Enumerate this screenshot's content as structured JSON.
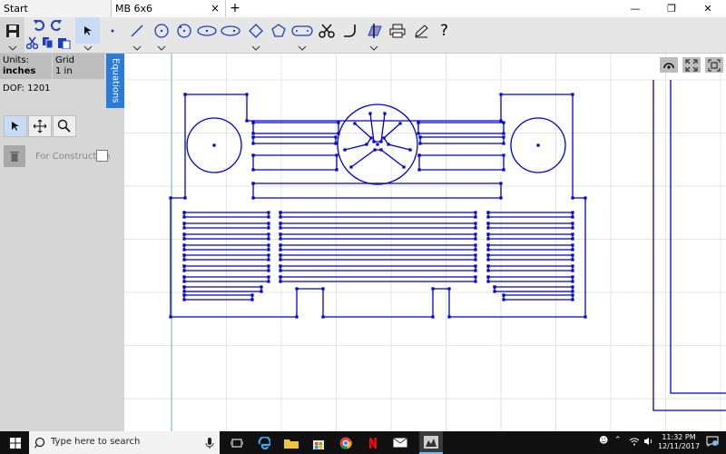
{
  "tabs": {
    "start": "Start",
    "document": "MB 6x6",
    "close": "×",
    "new": "+"
  },
  "window": {
    "minimize": "—",
    "restore": "❐",
    "close": "✕"
  },
  "toolbar": {
    "help": "?"
  },
  "panel": {
    "units_label": "Units:",
    "units_value": "inches",
    "grid_label": "Grid",
    "grid_value": "1 in",
    "dof": "DOF: 1201",
    "equations": "Equations",
    "for_construction": "For Construction"
  },
  "taskbar": {
    "search_placeholder": "Type here to search",
    "time": "11:32 PM",
    "date": "12/11/2017"
  },
  "colors": {
    "sketch": "#0000cc",
    "axis": "#7fc4a8",
    "accent": "#2b7bd9"
  }
}
